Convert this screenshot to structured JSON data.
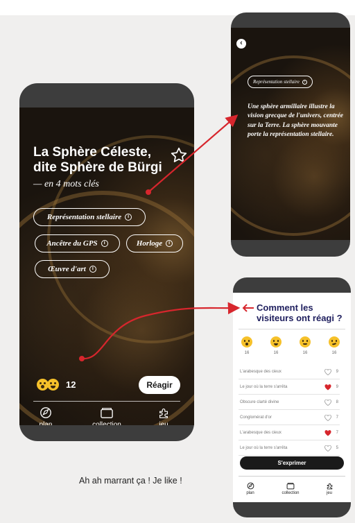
{
  "main_screen": {
    "title": "La Sphère Céleste, dite Sphère de Bürgi",
    "subtitle": "— en 4 mots clés",
    "tags": [
      {
        "label": "Représentation stellaire"
      },
      {
        "label": "Ancêtre du GPS"
      },
      {
        "label": "Horloge"
      },
      {
        "label": "Œuvre d'art"
      }
    ],
    "reaction_count": "12",
    "react_button": "Réagir",
    "nav": [
      {
        "label": "plan",
        "icon": "compass-icon"
      },
      {
        "label": "collection",
        "icon": "folder-icon"
      },
      {
        "label": "jeu",
        "icon": "puzzle-icon"
      }
    ]
  },
  "description_screen": {
    "tag": "Représentation stellaire",
    "text": "Une sphère armillaire illustre la vision grecque de l'univers, centrée sur la Terre. La sphère mouvante porte la représentation stellaire."
  },
  "reactions_screen": {
    "title": "Comment les visiteurs ont réagi ?",
    "emoji_counts": [
      "16",
      "16",
      "16",
      "16"
    ],
    "comments": [
      {
        "text": "L'arabesque des cieux",
        "count": "9",
        "liked": false
      },
      {
        "text": "Le jour où la terre s'arrêta",
        "count": "9",
        "liked": true
      },
      {
        "text": "Obscure clarté divine",
        "count": "8",
        "liked": false
      },
      {
        "text": "Conglomérat d'or",
        "count": "7",
        "liked": false
      },
      {
        "text": "L'arabesque des cieux",
        "count": "7",
        "liked": true
      },
      {
        "text": "Le jour où la terre s'arrêta",
        "count": "5",
        "liked": false
      }
    ],
    "express_button": "S'exprimer",
    "nav": [
      {
        "label": "plan",
        "icon": "compass-icon"
      },
      {
        "label": "collection",
        "icon": "folder-icon"
      },
      {
        "label": "jeu",
        "icon": "puzzle-icon"
      }
    ]
  },
  "caption": "Ah ah marrant ça ! Je like !",
  "colors": {
    "accent_red": "#d7262d",
    "title_navy": "#1f1f5e",
    "phone_frame": "#3d3d3d"
  }
}
